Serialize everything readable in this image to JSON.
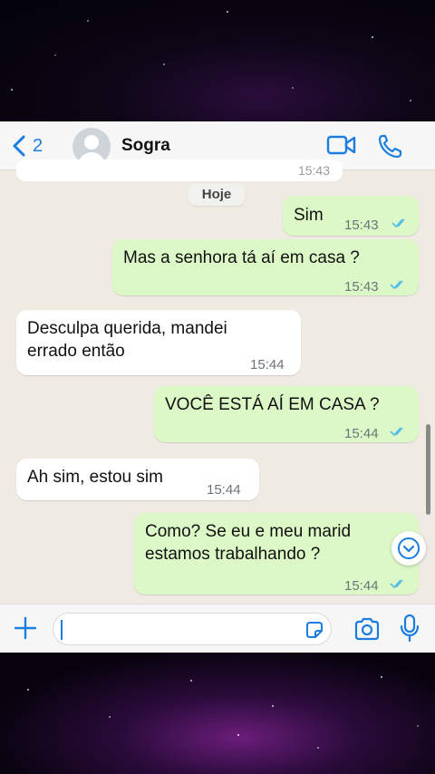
{
  "header": {
    "back_count": "2",
    "contact_name": "Sogra"
  },
  "chat": {
    "previous_time_fragment": "15:43",
    "day_label": "Hoje",
    "messages": [
      {
        "direction": "out",
        "text": "Sim",
        "time": "15:43"
      },
      {
        "direction": "out",
        "text": "Mas a senhora tá aí em casa ?",
        "time": "15:43"
      },
      {
        "direction": "in",
        "text": "Desculpa querida, mandei errado então",
        "time": "15:44"
      },
      {
        "direction": "out",
        "text": "VOCÊ ESTÁ AÍ EM CASA ?",
        "time": "15:44"
      },
      {
        "direction": "in",
        "text": "Ah sim, estou sim",
        "time": "15:44"
      },
      {
        "direction": "out",
        "text": "Como? Se eu e meu marid estamos trabalhando ?",
        "time": "15:44"
      }
    ]
  },
  "input": {
    "message_value": ""
  },
  "colors": {
    "accent": "#1a7ee0",
    "chat_background": "#efeae2",
    "outgoing_bubble": "#dcf8c6",
    "incoming_bubble": "#ffffff",
    "read_ticks": "#53bdeb"
  },
  "icons": [
    "chevron-left-icon",
    "avatar-placeholder-icon",
    "video-camera-icon",
    "phone-icon",
    "plus-icon",
    "sticker-icon",
    "camera-icon",
    "microphone-icon",
    "chevron-down-icon",
    "double-check-icon"
  ]
}
